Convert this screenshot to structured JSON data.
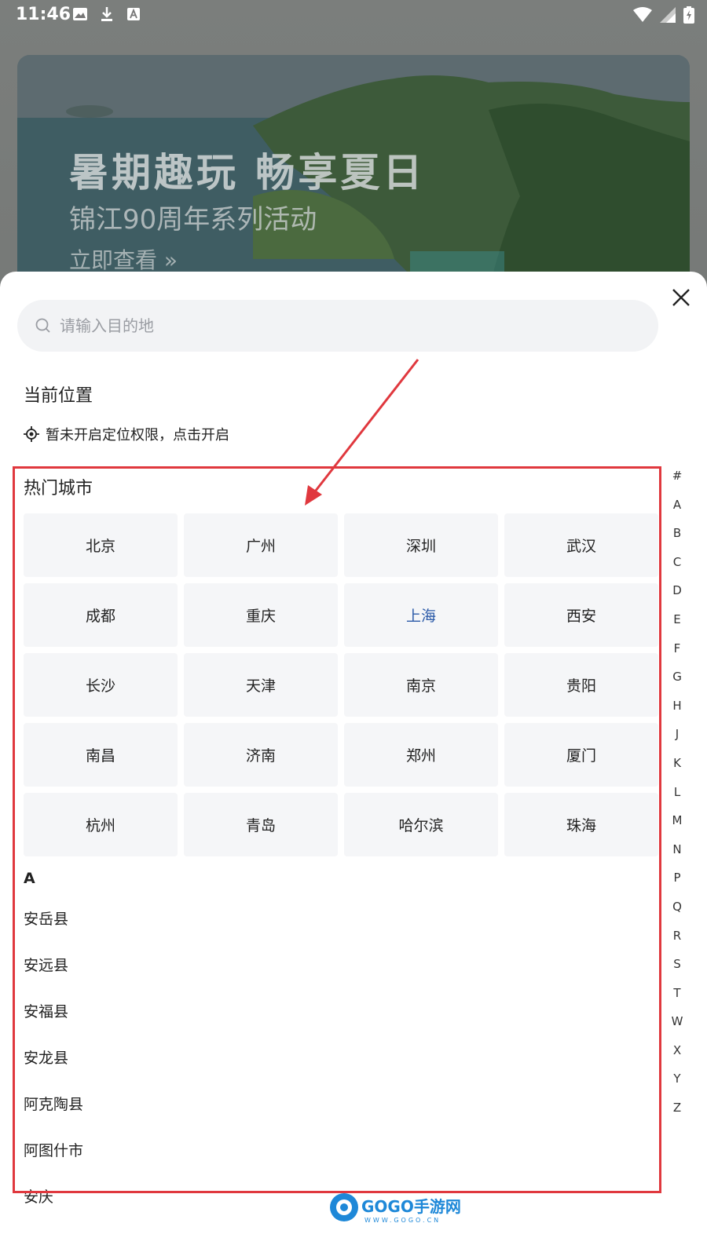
{
  "status_bar": {
    "time": "11:46"
  },
  "banner": {
    "title": "暑期趣玩 畅享夏日",
    "subtitle": "锦江90周年系列活动",
    "link": "立即查看 »"
  },
  "search": {
    "placeholder": "请输入目的地"
  },
  "current_location": {
    "title": "当前位置",
    "prompt": "暂未开启定位权限，点击开启"
  },
  "hot_cities": {
    "title": "热门城市",
    "cities": [
      "北京",
      "广州",
      "深圳",
      "武汉",
      "成都",
      "重庆",
      "上海",
      "西安",
      "长沙",
      "天津",
      "南京",
      "贵阳",
      "南昌",
      "济南",
      "郑州",
      "厦门",
      "杭州",
      "青岛",
      "哈尔滨",
      "珠海"
    ],
    "selected": "上海"
  },
  "city_list": {
    "letter": "A",
    "cities": [
      "安岳县",
      "安远县",
      "安福县",
      "安龙县",
      "阿克陶县",
      "阿图什市",
      "安庆"
    ]
  },
  "index_bar": [
    "#",
    "A",
    "B",
    "C",
    "D",
    "E",
    "F",
    "G",
    "H",
    "J",
    "K",
    "L",
    "M",
    "N",
    "P",
    "Q",
    "R",
    "S",
    "T",
    "W",
    "X",
    "Y",
    "Z"
  ],
  "watermark": {
    "brand": "GOGO手游网",
    "url": "WWW.GOGO.CN"
  },
  "colors": {
    "annotation_red": "#e0383e",
    "selected_blue": "#2b5aa8",
    "cell_bg": "#f5f6f8"
  }
}
